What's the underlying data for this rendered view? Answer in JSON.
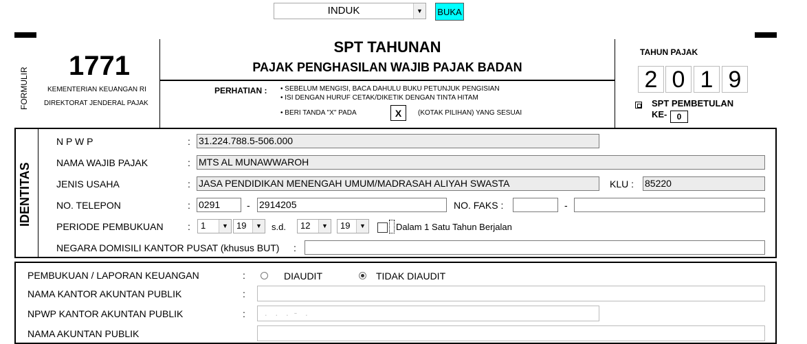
{
  "topbar": {
    "selected": "INDUK",
    "open_label": "BUKA"
  },
  "header": {
    "formulir": "FORMULIR",
    "form_number": "1771",
    "ministry": "KEMENTERIAN KEUANGAN RI",
    "directorate": "DIREKTORAT JENDERAL PAJAK",
    "title": "SPT TAHUNAN",
    "subtitle": "PAJAK PENGHASILAN WAJIB PAJAK BADAN",
    "attention_label": "PERHATIAN :",
    "notes": [
      "• SEBELUM MENGISI, BACA DAHULU BUKU PETUNJUK PENGISIAN",
      "• ISI DENGAN HURUF CETAK/DIKETIK DENGAN TINTA HITAM",
      "• BERI TANDA \"X\" PADA"
    ],
    "x_mark": "X",
    "note_suffix": "(KOTAK PILIHAN) YANG SESUAI",
    "tax_year_label": "TAHUN PAJAK",
    "tax_year_digits": [
      "2",
      "0",
      "1",
      "9"
    ],
    "pembetulan_label": "SPT PEMBETULAN",
    "ke_label": "KE-",
    "ke_value": "0"
  },
  "identitas": {
    "section_label": "IDENTITAS",
    "colon": ":",
    "npwp_label": "N P W P",
    "npwp_value": "31.224.788.5-506.000",
    "name_label": "NAMA WAJIB PAJAK",
    "name_value": "MTS AL MUNAWWAROH",
    "business_label": "JENIS USAHA",
    "business_value": "JASA PENDIDIKAN MENENGAH UMUM/MADRASAH ALIYAH SWASTA",
    "klu_label": "KLU :",
    "klu_value": "85220",
    "phone_label": "NO. TELEPON",
    "phone_area": "0291",
    "dash": "-",
    "phone_number": "2914205",
    "fax_label": "NO. FAKS :",
    "fax_area": "",
    "fax_number": "",
    "period_label": "PERIODE PEMBUKUAN",
    "period_start_month": "1",
    "period_start_year": "19",
    "sd_label": "s.d.",
    "period_end_month": "12",
    "period_end_year": "19",
    "within_year_label": "Dalam 1 Satu Tahun Berjalan",
    "country_label": "NEGARA DOMISILI KANTOR PUSAT (khusus BUT)",
    "country_value": ""
  },
  "accounting": {
    "books_label": "PEMBUKUAN / LAPORAN KEUANGAN",
    "colon": ":",
    "audited_label": "DIAUDIT",
    "not_audited_label": "TIDAK DIAUDIT",
    "kap_name_label": "NAMA KANTOR AKUNTAN PUBLIK",
    "kap_name_value": "",
    "kap_npwp_label": "NPWP KANTOR AKUNTAN PUBLIK",
    "kap_npwp_value": "  .   .   .  -   .",
    "accountant_label": "NAMA AKUNTAN PUBLIK"
  }
}
